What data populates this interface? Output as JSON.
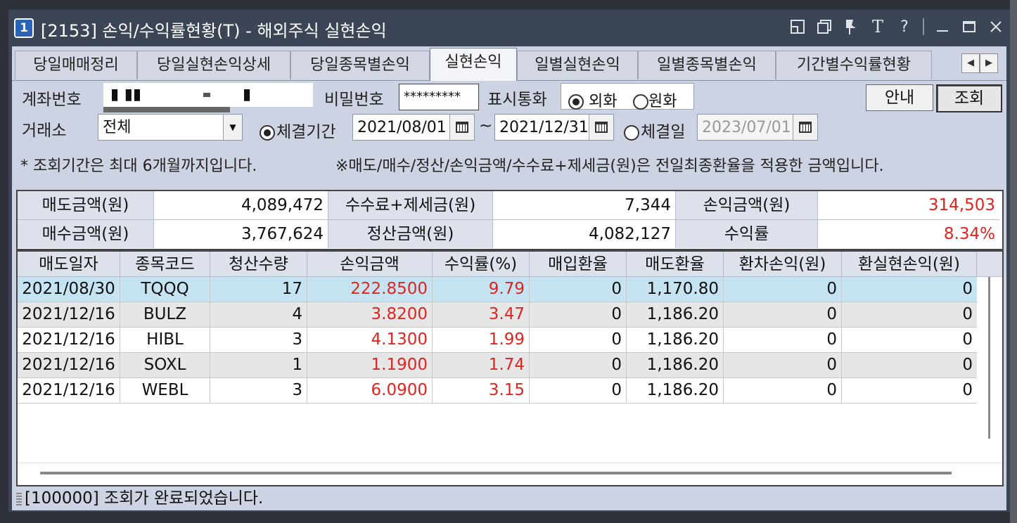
{
  "window": {
    "number_badge": "1",
    "title": "[2153] 손익/수익률현황(T) - 해외주식 실현손익",
    "controls": [
      "link-icon",
      "copy-icon",
      "pin-icon",
      "T",
      "?",
      "minimize-icon",
      "maximize-icon",
      "close-icon"
    ]
  },
  "tabs": [
    {
      "label": "당일매매정리",
      "active": false
    },
    {
      "label": "당일실현손익상세",
      "active": false
    },
    {
      "label": "당일종목별손익",
      "active": false
    },
    {
      "label": "실현손익",
      "active": true
    },
    {
      "label": "일별실현손익",
      "active": false
    },
    {
      "label": "일별종목별손익",
      "active": false
    },
    {
      "label": "기간별수익률현황",
      "active": false
    }
  ],
  "form": {
    "account_label": "계좌번호",
    "account_part1": "▮   ▮▮",
    "account_part2": "▮",
    "password_label": "비밀번호",
    "password_value": "*********",
    "currency_label": "표시통화",
    "currency_foreign": "외화",
    "currency_won": "원화",
    "guide_button": "안내",
    "query_button": "조회",
    "exchange_label": "거래소",
    "exchange_value": "전체",
    "period_label": "체결기간",
    "start_date": "2021/08/01",
    "tilde": "~",
    "end_date": "2021/12/31",
    "exec_date_label": "체결일",
    "exec_date": "2023/07/01",
    "note_left": "* 조회기간은 최대 6개월까지입니다.",
    "note_right": "※매도/매수/정산/손익금액/수수료+제세금(원)은 전일최종환율을 적용한 금액입니다."
  },
  "summary": {
    "sell_label": "매도금액(원)",
    "sell_value": "4,089,472",
    "fee_label": "수수료+제세금(원)",
    "fee_value": "7,344",
    "pl_label": "손익금액(원)",
    "pl_value": "314,503",
    "buy_label": "매수금액(원)",
    "buy_value": "3,767,624",
    "settle_label": "정산금액(원)",
    "settle_value": "4,082,127",
    "rate_label": "수익률",
    "rate_value": "8.34%"
  },
  "grid": {
    "columns": [
      "매도일자",
      "종목코드",
      "청산수량",
      "손익금액",
      "수익률(%)",
      "매입환율",
      "매도환율",
      "환차손익(원)",
      "환실현손익(원)"
    ],
    "rows": [
      [
        "2021/08/30",
        "TQQQ",
        "17",
        "222.8500",
        "9.79",
        "0",
        "1,170.80",
        "0",
        "0"
      ],
      [
        "2021/12/16",
        "BULZ",
        "4",
        "3.8200",
        "3.47",
        "0",
        "1,186.20",
        "0",
        "0"
      ],
      [
        "2021/12/16",
        "HIBL",
        "3",
        "4.1300",
        "1.99",
        "0",
        "1,186.20",
        "0",
        "0"
      ],
      [
        "2021/12/16",
        "SOXL",
        "1",
        "1.1900",
        "1.74",
        "0",
        "1,186.20",
        "0",
        "0"
      ],
      [
        "2021/12/16",
        "WEBL",
        "3",
        "6.0900",
        "3.15",
        "0",
        "1,186.20",
        "0",
        "0"
      ]
    ]
  },
  "status": {
    "message": "[100000] 조회가 완료되었습니다."
  },
  "colors": {
    "title_bar": "#3c4556",
    "panel": "#cdd3e2",
    "header_cell": "#dde1eb",
    "selected_row": "#c5e3f0",
    "alt_row": "#e6e6e6",
    "profit_red": "#e0241f"
  }
}
